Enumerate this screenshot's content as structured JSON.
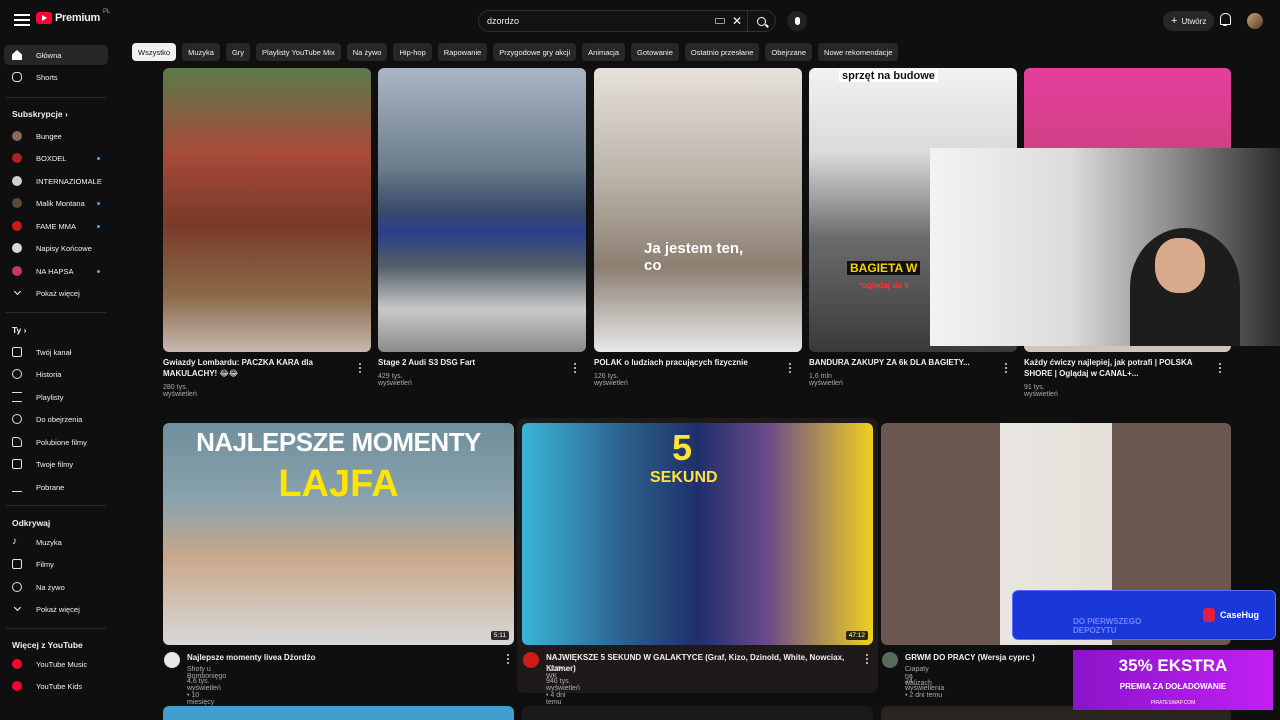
{
  "header": {
    "logo_text": "Premium",
    "logo_sup": "PL",
    "search_value": "dzordzo",
    "create_label": "Utwórz"
  },
  "chips": [
    "Wszystko",
    "Muzyka",
    "Gry",
    "Playlisty YouTube Mix",
    "Na żywo",
    "Hip-hop",
    "Rapowanie",
    "Przygodowe gry akcji",
    "Animacja",
    "Gotowanie",
    "Ostatnio przesłane",
    "Obejrzane",
    "Nowe rekomendacje"
  ],
  "sidebar": {
    "main": [
      {
        "label": "Główna",
        "icon": "home-icon"
      },
      {
        "label": "Shorts",
        "icon": "shorts-icon"
      }
    ],
    "subs_title": "Subskrypcje",
    "subs": [
      {
        "label": "Bungee",
        "color": "#8a6b5a",
        "live": false
      },
      {
        "label": "BOXDEL",
        "color": "#b02222",
        "live": true
      },
      {
        "label": "INTERNAZIOMALE",
        "color": "#d0d0d0",
        "live": false
      },
      {
        "label": "Malik Montana",
        "color": "#5a4a3a",
        "live": true
      },
      {
        "label": "FAME MMA",
        "color": "#cc1a1a",
        "live": true
      },
      {
        "label": "Napisy Końcowe",
        "color": "#d9d9d9",
        "live": false
      },
      {
        "label": "NA HAPSA",
        "color": "#c33a5a",
        "live": true
      }
    ],
    "subs_more": "Pokaż więcej",
    "you_title": "Ty",
    "you": [
      {
        "label": "Twój kanał",
        "icon": "channel-icon"
      },
      {
        "label": "Historia",
        "icon": "history-icon"
      },
      {
        "label": "Playlisty",
        "icon": "playlist-icon"
      },
      {
        "label": "Do obejrzenia",
        "icon": "watch-later-icon"
      },
      {
        "label": "Polubione filmy",
        "icon": "like-icon"
      },
      {
        "label": "Twoje filmy",
        "icon": "your-videos-icon"
      },
      {
        "label": "Pobrane",
        "icon": "download-icon"
      }
    ],
    "explore_title": "Odkrywaj",
    "explore": [
      {
        "label": "Muzyka",
        "icon": "music-icon"
      },
      {
        "label": "Filmy",
        "icon": "film-icon"
      },
      {
        "label": "Na żywo",
        "icon": "live-icon"
      }
    ],
    "explore_more": "Pokaż więcej",
    "more_title": "Więcej z YouTube",
    "more": [
      {
        "label": "YouTube Music",
        "icon": "youtube-music-icon"
      },
      {
        "label": "YouTube Kids",
        "icon": "youtube-kids-icon"
      }
    ]
  },
  "shorts_row": [
    {
      "title": "Gwiazdy Lombardu: PACZKA KARA dla MAKULACHY! 😂😂",
      "views": "280 tys. wyświetleń"
    },
    {
      "title": "Stage 2 Audi S3 DSG Fart",
      "views": "429 tys. wyświetleń"
    },
    {
      "title": "POLAK o ludziach pracujących fizycznie",
      "views": "126 tys. wyświetleń",
      "overlay": "Ja jestem ten, co"
    },
    {
      "title": "BANDURA ZAKUPY ZA 6k DLA BAGIETY...",
      "views": "1,6 mln wyświetleń",
      "overlay_top": "sprzęt na budowe",
      "overlay_mid": "BAGIETA W",
      "overlay_sub": "*oglądaj do k"
    },
    {
      "title": "Każdy ćwiczy najlepiej, jak potrafi | POLSKA SHORE | Oglądaj w CANAL+...",
      "views": "91 tys. wyświetleń"
    }
  ],
  "videos_row": [
    {
      "title": "Najlepsze momenty livea Dżordżo",
      "channel": "Shoty u Bombonięgo",
      "meta": "4,6 tys. wyświetleń • 10 miesięcy temu",
      "duration": "5:11",
      "thumb_line1": "NAJLEPSZE MOMENTY",
      "thumb_line2": "LAJFA"
    },
    {
      "title": "NAJWIĘKSZE 5 SEKUND W GALAKTYCE (Graf, Kizo, Dzinold, White, Nowciax, Klamer)",
      "channel": "EKIPA WK",
      "meta": "946 tys. wyświetleń • 4 dni temu",
      "duration": "47:12",
      "thumb_badge": "5",
      "thumb_badge_word": "SEKUND"
    },
    {
      "title": "GRWM DO PRACY (Wersja cyprc )",
      "channel": "Ciapaty na walizach",
      "meta": "24 wyświetlenia • 2 dni temu"
    }
  ],
  "overlays": {
    "casehug_brand": "CaseHug",
    "casehug_text": "DO PIERWSZEGO DEPOZYTU",
    "promo_big": "35% EKSTRA",
    "promo_small": "PREMIA ZA DOŁADOWANIE",
    "promo_url": "PIRATESWAP.COM"
  },
  "colors": {
    "accent": "#ff0033",
    "bg": "#0f0f0f",
    "chip": "#272727",
    "live": "#3ea6ff"
  }
}
